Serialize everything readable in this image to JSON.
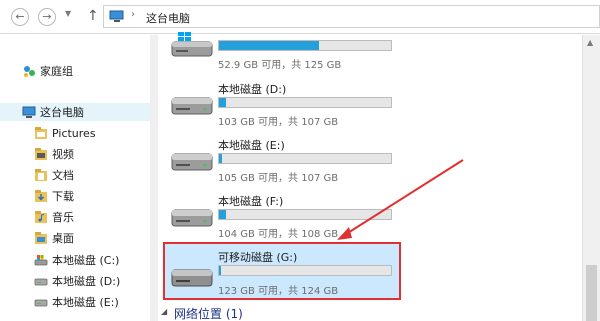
{
  "address_bar": {
    "breadcrumb_separator": "›",
    "location": "这台电脑"
  },
  "nav_pane": {
    "homegroup": "家庭组",
    "this_pc": "这台电脑",
    "items": [
      {
        "label": "Pictures",
        "icon": "pictures-folder-icon"
      },
      {
        "label": "视频",
        "icon": "videos-folder-icon"
      },
      {
        "label": "文档",
        "icon": "documents-folder-icon"
      },
      {
        "label": "下载",
        "icon": "downloads-folder-icon"
      },
      {
        "label": "音乐",
        "icon": "music-folder-icon"
      },
      {
        "label": "桌面",
        "icon": "desktop-folder-icon"
      },
      {
        "label": "本地磁盘 (C:)",
        "icon": "system-drive-icon"
      },
      {
        "label": "本地磁盘 (D:)",
        "icon": "drive-icon"
      },
      {
        "label": "本地磁盘 (E:)",
        "icon": "drive-icon"
      }
    ]
  },
  "drives": [
    {
      "name": "",
      "info": "52.9 GB 可用，共 125 GB",
      "used_fraction": 0.58
    },
    {
      "name": "本地磁盘 (D:)",
      "info": "103 GB 可用，共 107 GB",
      "used_fraction": 0.04
    },
    {
      "name": "本地磁盘 (E:)",
      "info": "105 GB 可用，共 107 GB",
      "used_fraction": 0.02
    },
    {
      "name": "本地磁盘 (F:)",
      "info": "104 GB 可用，共 108 GB",
      "used_fraction": 0.04
    },
    {
      "name": "可移动磁盘 (G:)",
      "info": "123 GB 可用，共 124 GB",
      "used_fraction": 0.01
    }
  ],
  "network_group": {
    "label": "网络位置 (1)"
  },
  "colors": {
    "progress_fill": "#26a0da",
    "selection_bg": "#cce8ff",
    "annotation_red": "#e03030"
  }
}
